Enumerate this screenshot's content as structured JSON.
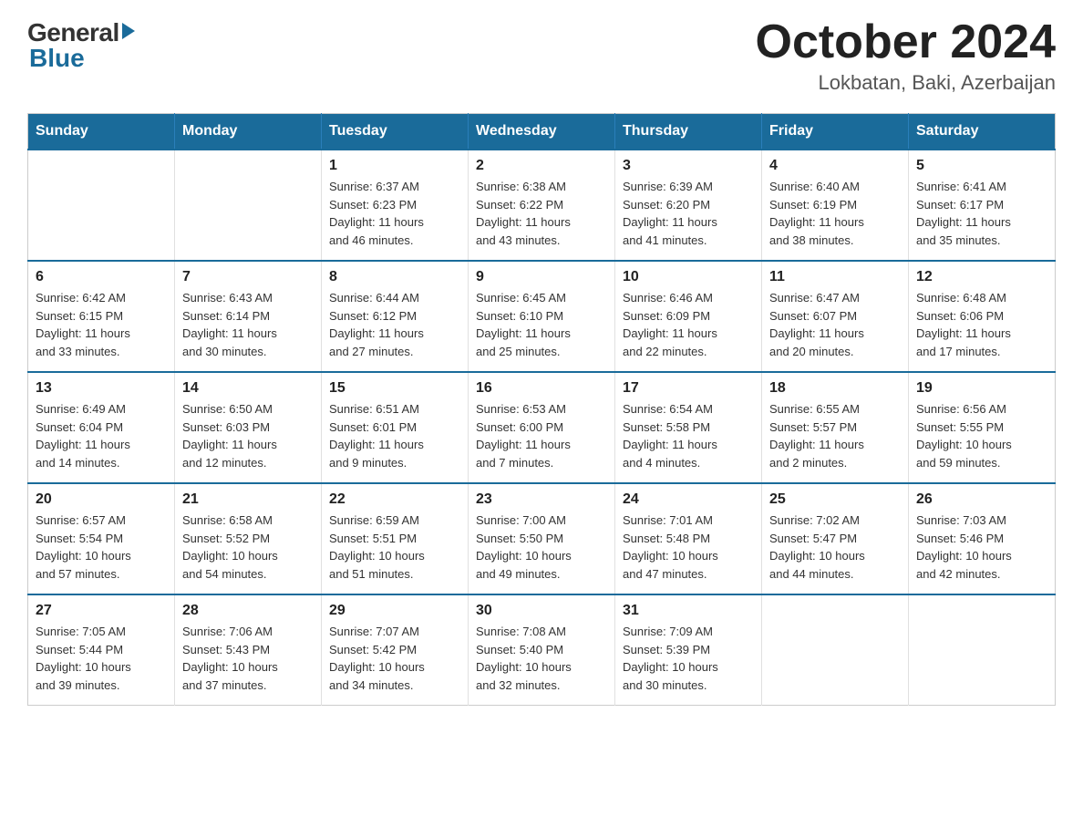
{
  "header": {
    "logo_general": "General",
    "logo_blue": "Blue",
    "month": "October 2024",
    "location": "Lokbatan, Baki, Azerbaijan"
  },
  "days_of_week": [
    "Sunday",
    "Monday",
    "Tuesday",
    "Wednesday",
    "Thursday",
    "Friday",
    "Saturday"
  ],
  "weeks": [
    [
      {
        "day": "",
        "info": ""
      },
      {
        "day": "",
        "info": ""
      },
      {
        "day": "1",
        "info": "Sunrise: 6:37 AM\nSunset: 6:23 PM\nDaylight: 11 hours\nand 46 minutes."
      },
      {
        "day": "2",
        "info": "Sunrise: 6:38 AM\nSunset: 6:22 PM\nDaylight: 11 hours\nand 43 minutes."
      },
      {
        "day": "3",
        "info": "Sunrise: 6:39 AM\nSunset: 6:20 PM\nDaylight: 11 hours\nand 41 minutes."
      },
      {
        "day": "4",
        "info": "Sunrise: 6:40 AM\nSunset: 6:19 PM\nDaylight: 11 hours\nand 38 minutes."
      },
      {
        "day": "5",
        "info": "Sunrise: 6:41 AM\nSunset: 6:17 PM\nDaylight: 11 hours\nand 35 minutes."
      }
    ],
    [
      {
        "day": "6",
        "info": "Sunrise: 6:42 AM\nSunset: 6:15 PM\nDaylight: 11 hours\nand 33 minutes."
      },
      {
        "day": "7",
        "info": "Sunrise: 6:43 AM\nSunset: 6:14 PM\nDaylight: 11 hours\nand 30 minutes."
      },
      {
        "day": "8",
        "info": "Sunrise: 6:44 AM\nSunset: 6:12 PM\nDaylight: 11 hours\nand 27 minutes."
      },
      {
        "day": "9",
        "info": "Sunrise: 6:45 AM\nSunset: 6:10 PM\nDaylight: 11 hours\nand 25 minutes."
      },
      {
        "day": "10",
        "info": "Sunrise: 6:46 AM\nSunset: 6:09 PM\nDaylight: 11 hours\nand 22 minutes."
      },
      {
        "day": "11",
        "info": "Sunrise: 6:47 AM\nSunset: 6:07 PM\nDaylight: 11 hours\nand 20 minutes."
      },
      {
        "day": "12",
        "info": "Sunrise: 6:48 AM\nSunset: 6:06 PM\nDaylight: 11 hours\nand 17 minutes."
      }
    ],
    [
      {
        "day": "13",
        "info": "Sunrise: 6:49 AM\nSunset: 6:04 PM\nDaylight: 11 hours\nand 14 minutes."
      },
      {
        "day": "14",
        "info": "Sunrise: 6:50 AM\nSunset: 6:03 PM\nDaylight: 11 hours\nand 12 minutes."
      },
      {
        "day": "15",
        "info": "Sunrise: 6:51 AM\nSunset: 6:01 PM\nDaylight: 11 hours\nand 9 minutes."
      },
      {
        "day": "16",
        "info": "Sunrise: 6:53 AM\nSunset: 6:00 PM\nDaylight: 11 hours\nand 7 minutes."
      },
      {
        "day": "17",
        "info": "Sunrise: 6:54 AM\nSunset: 5:58 PM\nDaylight: 11 hours\nand 4 minutes."
      },
      {
        "day": "18",
        "info": "Sunrise: 6:55 AM\nSunset: 5:57 PM\nDaylight: 11 hours\nand 2 minutes."
      },
      {
        "day": "19",
        "info": "Sunrise: 6:56 AM\nSunset: 5:55 PM\nDaylight: 10 hours\nand 59 minutes."
      }
    ],
    [
      {
        "day": "20",
        "info": "Sunrise: 6:57 AM\nSunset: 5:54 PM\nDaylight: 10 hours\nand 57 minutes."
      },
      {
        "day": "21",
        "info": "Sunrise: 6:58 AM\nSunset: 5:52 PM\nDaylight: 10 hours\nand 54 minutes."
      },
      {
        "day": "22",
        "info": "Sunrise: 6:59 AM\nSunset: 5:51 PM\nDaylight: 10 hours\nand 51 minutes."
      },
      {
        "day": "23",
        "info": "Sunrise: 7:00 AM\nSunset: 5:50 PM\nDaylight: 10 hours\nand 49 minutes."
      },
      {
        "day": "24",
        "info": "Sunrise: 7:01 AM\nSunset: 5:48 PM\nDaylight: 10 hours\nand 47 minutes."
      },
      {
        "day": "25",
        "info": "Sunrise: 7:02 AM\nSunset: 5:47 PM\nDaylight: 10 hours\nand 44 minutes."
      },
      {
        "day": "26",
        "info": "Sunrise: 7:03 AM\nSunset: 5:46 PM\nDaylight: 10 hours\nand 42 minutes."
      }
    ],
    [
      {
        "day": "27",
        "info": "Sunrise: 7:05 AM\nSunset: 5:44 PM\nDaylight: 10 hours\nand 39 minutes."
      },
      {
        "day": "28",
        "info": "Sunrise: 7:06 AM\nSunset: 5:43 PM\nDaylight: 10 hours\nand 37 minutes."
      },
      {
        "day": "29",
        "info": "Sunrise: 7:07 AM\nSunset: 5:42 PM\nDaylight: 10 hours\nand 34 minutes."
      },
      {
        "day": "30",
        "info": "Sunrise: 7:08 AM\nSunset: 5:40 PM\nDaylight: 10 hours\nand 32 minutes."
      },
      {
        "day": "31",
        "info": "Sunrise: 7:09 AM\nSunset: 5:39 PM\nDaylight: 10 hours\nand 30 minutes."
      },
      {
        "day": "",
        "info": ""
      },
      {
        "day": "",
        "info": ""
      }
    ]
  ]
}
